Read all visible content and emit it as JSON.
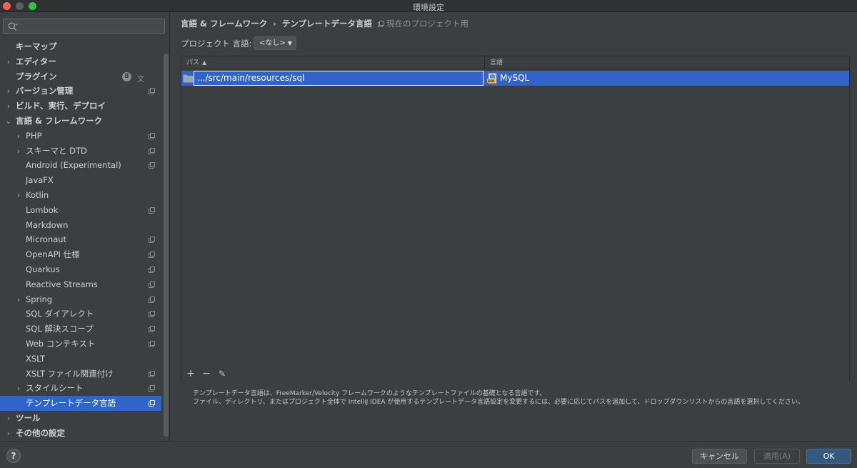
{
  "window": {
    "title": "環境設定"
  },
  "sidebar": {
    "search_placeholder": "",
    "items": [
      {
        "label": "キーマップ",
        "level": 0,
        "expandable": false,
        "bold": true
      },
      {
        "label": "エディター",
        "level": 0,
        "expandable": true,
        "expanded": false,
        "bold": true
      },
      {
        "label": "プラグイン",
        "level": 0,
        "expandable": false,
        "bold": true,
        "badge": "8",
        "translate_icon": true
      },
      {
        "label": "バージョン管理",
        "level": 0,
        "expandable": true,
        "expanded": false,
        "bold": true,
        "project_icon": true
      },
      {
        "label": "ビルド、実行、デプロイ",
        "level": 0,
        "expandable": true,
        "expanded": false,
        "bold": true
      },
      {
        "label": "言語 & フレームワーク",
        "level": 0,
        "expandable": true,
        "expanded": true,
        "bold": true
      },
      {
        "label": "PHP",
        "level": 1,
        "expandable": true,
        "expanded": false,
        "project_icon": true
      },
      {
        "label": "スキーマと DTD",
        "level": 1,
        "expandable": true,
        "expanded": false,
        "project_icon": true
      },
      {
        "label": "Android (Experimental)",
        "level": 1,
        "expandable": false,
        "project_icon": true
      },
      {
        "label": "JavaFX",
        "level": 1,
        "expandable": false
      },
      {
        "label": "Kotlin",
        "level": 1,
        "expandable": true,
        "expanded": false
      },
      {
        "label": "Lombok",
        "level": 1,
        "expandable": false,
        "project_icon": true
      },
      {
        "label": "Markdown",
        "level": 1,
        "expandable": false
      },
      {
        "label": "Micronaut",
        "level": 1,
        "expandable": false,
        "project_icon": true
      },
      {
        "label": "OpenAPI 仕様",
        "level": 1,
        "expandable": false,
        "project_icon": true
      },
      {
        "label": "Quarkus",
        "level": 1,
        "expandable": false,
        "project_icon": true
      },
      {
        "label": "Reactive Streams",
        "level": 1,
        "expandable": false,
        "project_icon": true
      },
      {
        "label": "Spring",
        "level": 1,
        "expandable": true,
        "expanded": false,
        "project_icon": true
      },
      {
        "label": "SQL ダイアレクト",
        "level": 1,
        "expandable": false,
        "project_icon": true
      },
      {
        "label": "SQL 解決スコープ",
        "level": 1,
        "expandable": false,
        "project_icon": true
      },
      {
        "label": "Web コンテキスト",
        "level": 1,
        "expandable": false,
        "project_icon": true
      },
      {
        "label": "XSLT",
        "level": 1,
        "expandable": false
      },
      {
        "label": "XSLT ファイル関連付け",
        "level": 1,
        "expandable": false,
        "project_icon": true
      },
      {
        "label": "スタイルシート",
        "level": 1,
        "expandable": true,
        "expanded": false,
        "project_icon": true
      },
      {
        "label": "テンプレートデータ言語",
        "level": 1,
        "expandable": false,
        "project_icon": true,
        "selected": true
      },
      {
        "label": "ツール",
        "level": 0,
        "expandable": true,
        "expanded": false,
        "bold": true
      },
      {
        "label": "その他の設定",
        "level": 0,
        "expandable": true,
        "expanded": false,
        "bold": true
      }
    ]
  },
  "main": {
    "breadcrumb": [
      "言語 & フレームワーク",
      "テンプレートデータ言語"
    ],
    "breadcrumb_separator": "›",
    "scope_note": "現在のプロジェクト用",
    "project_language_label": "プロジェクト 言語:",
    "project_language_value": "<なし>",
    "table": {
      "headers": {
        "path": "パス",
        "path_sort": "▲",
        "language": "言語"
      },
      "rows": [
        {
          "path": ".../src/main/resources/sql",
          "language": "MySQL",
          "selected": true
        }
      ],
      "toolbar": {
        "add": "+",
        "remove": "−",
        "edit": "✎"
      }
    },
    "description": [
      "テンプレートデータ言語は、FreeMarker/Velocity フレームワークのようなテンプレートファイルの基礎となる言語です。",
      "ファイル、ディレクトリ、またはプロジェクト全体で IntelliJ IDEA が使用するテンプレートデータ言語設定を変更するには、必要に応じてパスを追加して、ドロップダウンリストからの言語を選択してください。"
    ]
  },
  "footer": {
    "help": "?",
    "cancel": "キャンセル",
    "apply": "適用(A)",
    "ok": "OK"
  },
  "colors": {
    "background": "#3c3f41",
    "selection": "#2f65ca",
    "ok_button": "#365880"
  },
  "icons": {
    "search": "search-icon",
    "chevron": "chevron-right-icon",
    "project_scope": "project-scope-icon",
    "folder": "folder-icon",
    "sql_file": "sql-file-icon"
  }
}
